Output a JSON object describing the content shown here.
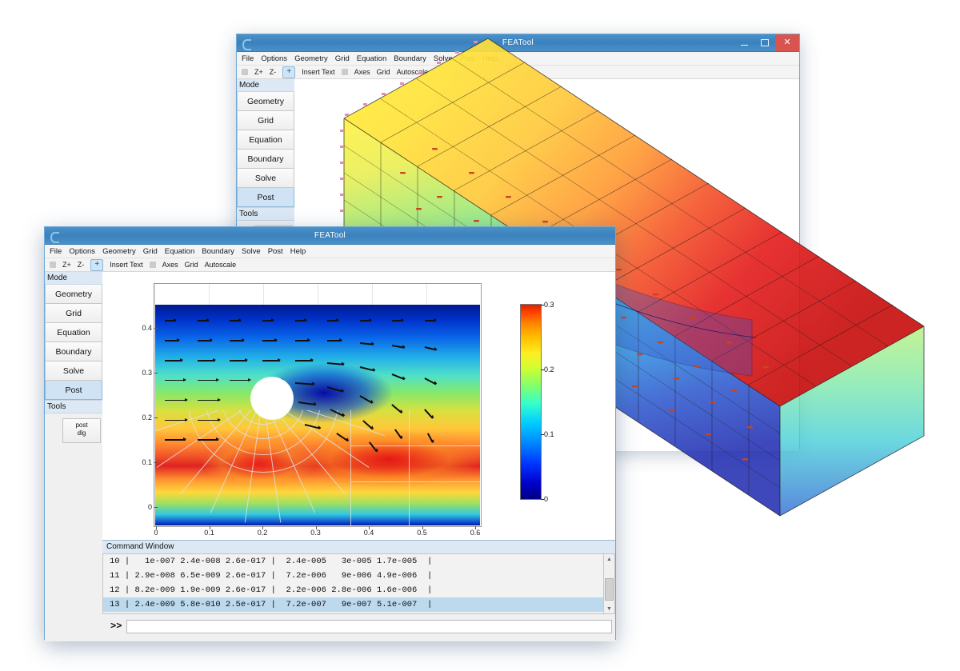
{
  "app": {
    "title": "FEATool"
  },
  "window_controls": {
    "minimize": "minimize-icon",
    "maximize": "maximize-icon",
    "close": "close-icon"
  },
  "menu": {
    "items": [
      "File",
      "Options",
      "Geometry",
      "Grid",
      "Equation",
      "Boundary",
      "Solve",
      "Post",
      "Help"
    ]
  },
  "toolbar": {
    "items": [
      "Z+",
      "Z-",
      "+",
      "Insert Text",
      "Axes",
      "Grid",
      "Autoscale"
    ],
    "zoom_in": "Z+",
    "zoom_out": "Z-",
    "plus": "+",
    "insert_text": "Insert Text",
    "axes": "Axes",
    "grid": "Grid",
    "autoscale": "Autoscale"
  },
  "sidebar": {
    "mode_header": "Mode",
    "tools_header": "Tools",
    "items": [
      {
        "label": "Geometry",
        "selected": false
      },
      {
        "label": "Grid",
        "selected": false
      },
      {
        "label": "Equation",
        "selected": false
      },
      {
        "label": "Boundary",
        "selected": false
      },
      {
        "label": "Solve",
        "selected": false
      },
      {
        "label": "Post",
        "selected": true
      }
    ],
    "post_dlg_line1": "post",
    "post_dlg_line2": "dlg"
  },
  "command_window": {
    "title": "Command Window",
    "prompt": "&gt;&gt;",
    "input_value": "",
    "lines": [
      {
        "text": "10 |   1e-007 2.4e-008 2.6e-017 |  2.4e-005   3e-005 1.7e-005  |",
        "selected": false
      },
      {
        "text": "11 | 2.9e-008 6.5e-009 2.6e-017 |  7.2e-006   9e-006 4.9e-006  |",
        "selected": false
      },
      {
        "text": "12 | 8.2e-009 1.9e-009 2.6e-017 |  2.2e-006 2.8e-006 1.6e-006  |",
        "selected": false
      },
      {
        "text": "13 | 2.4e-009 5.8e-010 2.5e-017 |  7.2e-007   9e-007 5.1e-007  |",
        "selected": true
      }
    ]
  },
  "chart_data": {
    "type": "heatmap",
    "title": "",
    "xlabel": "",
    "ylabel": "",
    "description": "2D CFD flow-past-cylinder field plot with velocity arrow glyphs and mesh overlay",
    "xlim": [
      0,
      0.65
    ],
    "ylim": [
      0,
      0.41
    ],
    "xticks": [
      0,
      0.1,
      0.2,
      0.3,
      0.4,
      0.5,
      0.6
    ],
    "xtick_labels": [
      "0",
      "0.1",
      "0.2",
      "0.3",
      "0.4",
      "0.5",
      "0.6"
    ],
    "yticks": [
      0,
      0.1,
      0.2,
      0.3,
      0.4
    ],
    "ytick_labels": [
      "0",
      "0.1",
      "0.2",
      "0.3",
      "0.4"
    ],
    "colorbar": {
      "ticks": [
        0,
        0.1,
        0.2,
        0.3
      ],
      "tick_labels": [
        "0",
        "0.1",
        "0.2",
        "0.3"
      ],
      "min": 0,
      "max": 0.3,
      "colormap": "jet",
      "position": "right"
    },
    "cylinder": {
      "center_x": 0.2,
      "center_y": 0.2,
      "radius": 0.05
    },
    "grid": false
  },
  "scene_3d": {
    "type": "volume-mesh",
    "description": "3D hexahedral beam mesh colored with jet colormap, wireframe grid and arrow glyphs",
    "colormap": "jet"
  },
  "colors": {
    "titlebar": "#3b82bd",
    "close_button": "#d9534f",
    "selected_item": "#cfe3f4",
    "panel_header": "#dce9f5",
    "window_border": "#6fa8d6",
    "selected_row": "#bcd9ee"
  }
}
